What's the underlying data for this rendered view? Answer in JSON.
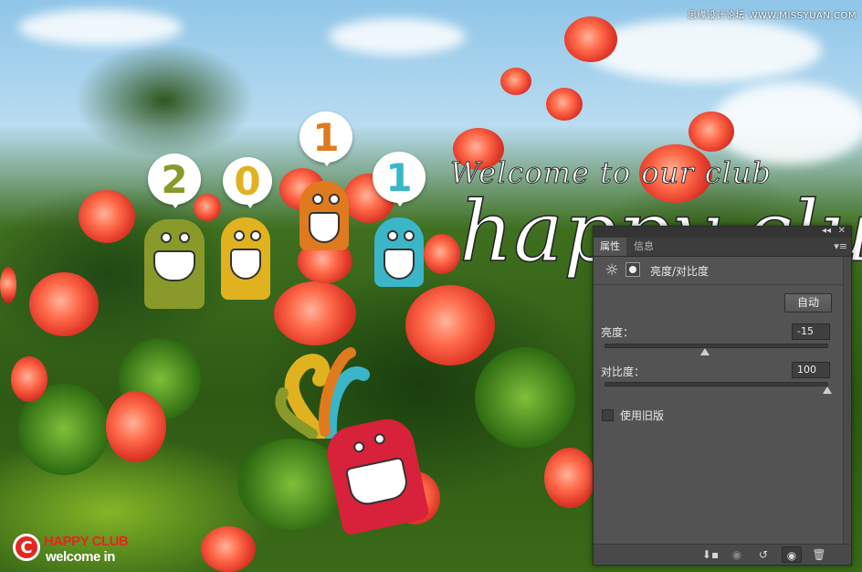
{
  "watermark": "思缘设计论坛 WWW.MISSYUAN.COM",
  "artwork": {
    "welcome_text": "Welcome to our club",
    "happy_text": "happy club",
    "digits": [
      "2",
      "0",
      "1",
      "1"
    ],
    "digit_colors": [
      "#8a9a2a",
      "#e1b21f",
      "#e07a1e",
      "#3ab6c8"
    ],
    "logo_letter": "C",
    "logo_line1": "HAPPY CLUB",
    "logo_line2": "welcome in"
  },
  "panel": {
    "tabs": [
      "属性",
      "信息"
    ],
    "active_tab": "属性",
    "title_controls": [
      "◂◂",
      "✕"
    ],
    "menu_icon": "panel-menu-icon",
    "adjustment_title": "亮度/对比度",
    "auto_label": "自动",
    "brightness": {
      "label": "亮度：",
      "value": "-15",
      "fraction": 0.45
    },
    "contrast": {
      "label": "对比度：",
      "value": "100",
      "fraction": 1.0
    },
    "legacy_label": "使用旧版",
    "legacy_checked": false,
    "bottom_icons": [
      "clip-to-layer-icon",
      "view-previous-icon",
      "reset-icon",
      "visibility-eye-icon",
      "delete-trash-icon"
    ]
  }
}
